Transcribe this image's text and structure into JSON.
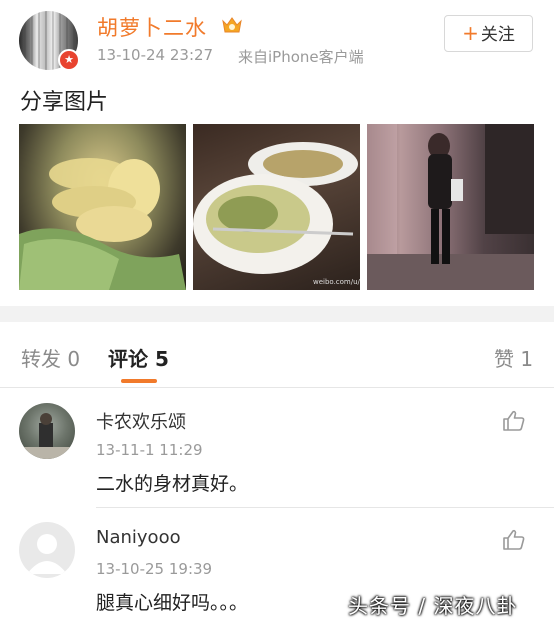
{
  "post": {
    "user_name": "胡萝卜二水",
    "time": "13-10-24 23:27",
    "source": "来自iPhone客户端",
    "follow_label": "关注",
    "follow_plus": "+",
    "text": "分享图片",
    "photo_caption_small": "weibo.com/u/947"
  },
  "tabs": {
    "repost": "转发 0",
    "comments": "评论 5",
    "likes": "赞 1"
  },
  "comments": [
    {
      "name": "卡农欢乐颂",
      "time": "13-11-1 11:29",
      "text": "二水的身材真好。"
    },
    {
      "name": "Naniyooo",
      "time": "13-10-25 19:39",
      "text": "腿真心细好吗。。。"
    }
  ],
  "watermark": "头条号 / 深夜八卦",
  "colors": {
    "accent": "#f17a2b",
    "badge": "#e8432f"
  },
  "icons": [
    "verified-badge-icon",
    "vip-crown-icon",
    "thumbs-up-icon"
  ]
}
